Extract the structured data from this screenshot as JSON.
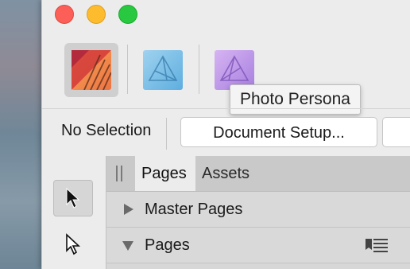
{
  "window": {
    "traffic_lights": {
      "close": "#fc5f57",
      "minimize": "#fdbc2e",
      "maximize": "#28c840"
    }
  },
  "personas": [
    {
      "name": "designer-persona-icon",
      "active": true,
      "color": "#f08a4b"
    },
    {
      "name": "pixel-persona-icon",
      "active": false,
      "color": "#6ab8e0"
    },
    {
      "name": "photo-persona-icon",
      "active": false,
      "color": "#b98ee0"
    }
  ],
  "tooltip": {
    "text": "Photo Persona"
  },
  "context_toolbar": {
    "selection_label": "No Selection",
    "document_setup_label": "Document Setup..."
  },
  "tools": [
    {
      "name": "move-tool-icon",
      "active": true
    },
    {
      "name": "node-tool-icon",
      "active": false
    }
  ],
  "panel": {
    "tabs": [
      {
        "label": "Pages",
        "active": true
      },
      {
        "label": "Assets",
        "active": false
      }
    ],
    "sections": [
      {
        "label": "Master Pages",
        "expanded": false
      },
      {
        "label": "Pages",
        "expanded": true
      }
    ]
  }
}
